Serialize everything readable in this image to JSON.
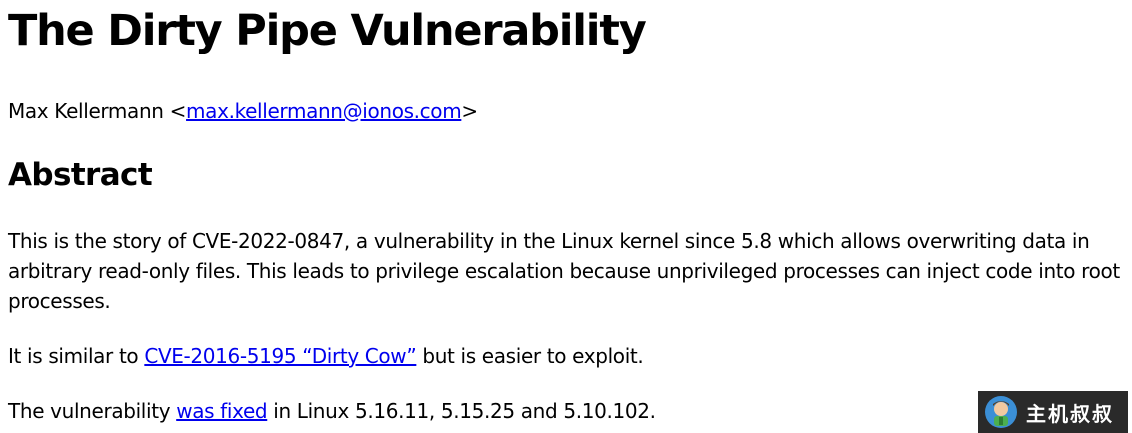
{
  "title": "The Dirty Pipe Vulnerability",
  "author": {
    "name": "Max Kellermann",
    "open": "<",
    "email": "max.kellermann@ionos.com",
    "close": ">"
  },
  "abstract_heading": "Abstract",
  "para1": "This is the story of CVE-2022-0847, a vulnerability in the Linux kernel since 5.8 which allows overwriting data in arbitrary read-only files. This leads to privilege escalation because unprivileged processes can inject code into root processes.",
  "para2": {
    "before": "It is similar to ",
    "link": "CVE-2016-5195 “Dirty Cow”",
    "after": " but is easier to exploit."
  },
  "para3": {
    "before": "The vulnerability ",
    "link": "was fixed",
    "after": " in Linux 5.16.11, 5.15.25 and 5.10.102."
  },
  "watermark": {
    "text": "主机叔叔",
    "icon": "mascot-icon",
    "background": "#2a2a2a"
  },
  "colors": {
    "link": "#0000ee",
    "text": "#000000",
    "background": "#ffffff"
  }
}
